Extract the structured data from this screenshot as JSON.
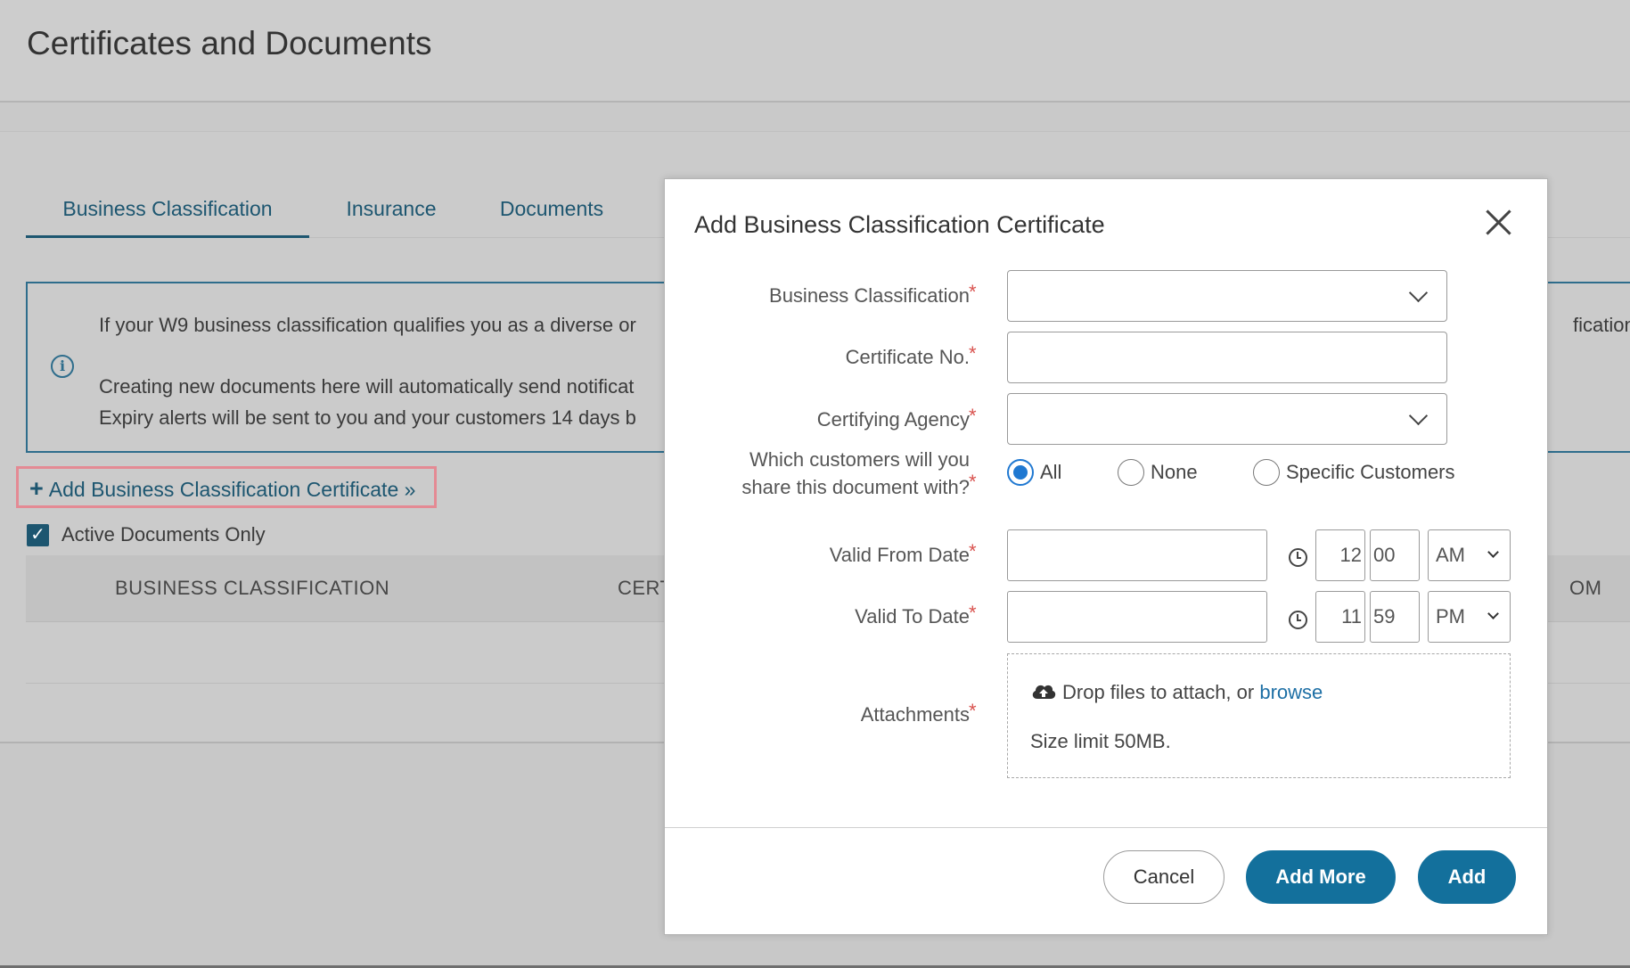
{
  "page": {
    "title": "Certificates and Documents"
  },
  "tabs": [
    {
      "label": "Business Classification"
    },
    {
      "label": "Insurance"
    },
    {
      "label": "Documents"
    }
  ],
  "info": {
    "line1": "If your W9 business classification qualifies you as a diverse or",
    "line1_tail": "fications",
    "line2": "Creating new documents here will automatically send notificat",
    "line3": "Expiry alerts will be sent to you and your customers 14 days b"
  },
  "add_link": {
    "plus": "+",
    "label": "Add Business Classification Certificate »"
  },
  "active_only": {
    "label": "Active Documents Only",
    "checked": true
  },
  "grid": {
    "columns": [
      "BUSINESS CLASSIFICATION",
      "CERT",
      "OM"
    ]
  },
  "modal": {
    "title": "Add Business Classification Certificate",
    "required_mark": "*",
    "fields": {
      "business_classification": {
        "label": "Business Classification",
        "value": ""
      },
      "certificate_no": {
        "label": "Certificate No.",
        "value": ""
      },
      "certifying_agency": {
        "label": "Certifying Agency",
        "value": ""
      },
      "share_with": {
        "label_line1": "Which customers will you",
        "label_line2": "share this document with?",
        "options": [
          "All",
          "None",
          "Specific Customers"
        ],
        "selected": "All"
      },
      "valid_from": {
        "label": "Valid From Date",
        "hour": "12",
        "minute": "00",
        "ampm": "AM"
      },
      "valid_to": {
        "label": "Valid To Date",
        "hour": "11",
        "minute": "59",
        "ampm": "PM"
      },
      "attachments": {
        "label": "Attachments",
        "drop_text": "Drop files to attach, or ",
        "browse": "browse",
        "size_limit": "Size limit 50MB."
      }
    },
    "buttons": {
      "cancel": "Cancel",
      "add_more": "Add More",
      "add": "Add"
    }
  },
  "colors": {
    "accent": "#13709c",
    "link": "#1d5670",
    "required": "#d9534f",
    "radio_selected": "#1f78d1"
  },
  "icons": {
    "info": "info-circle-icon",
    "close": "close-icon",
    "clock": "clock-icon",
    "upload": "cloud-upload-icon",
    "check": "checkbox-checked-icon"
  }
}
